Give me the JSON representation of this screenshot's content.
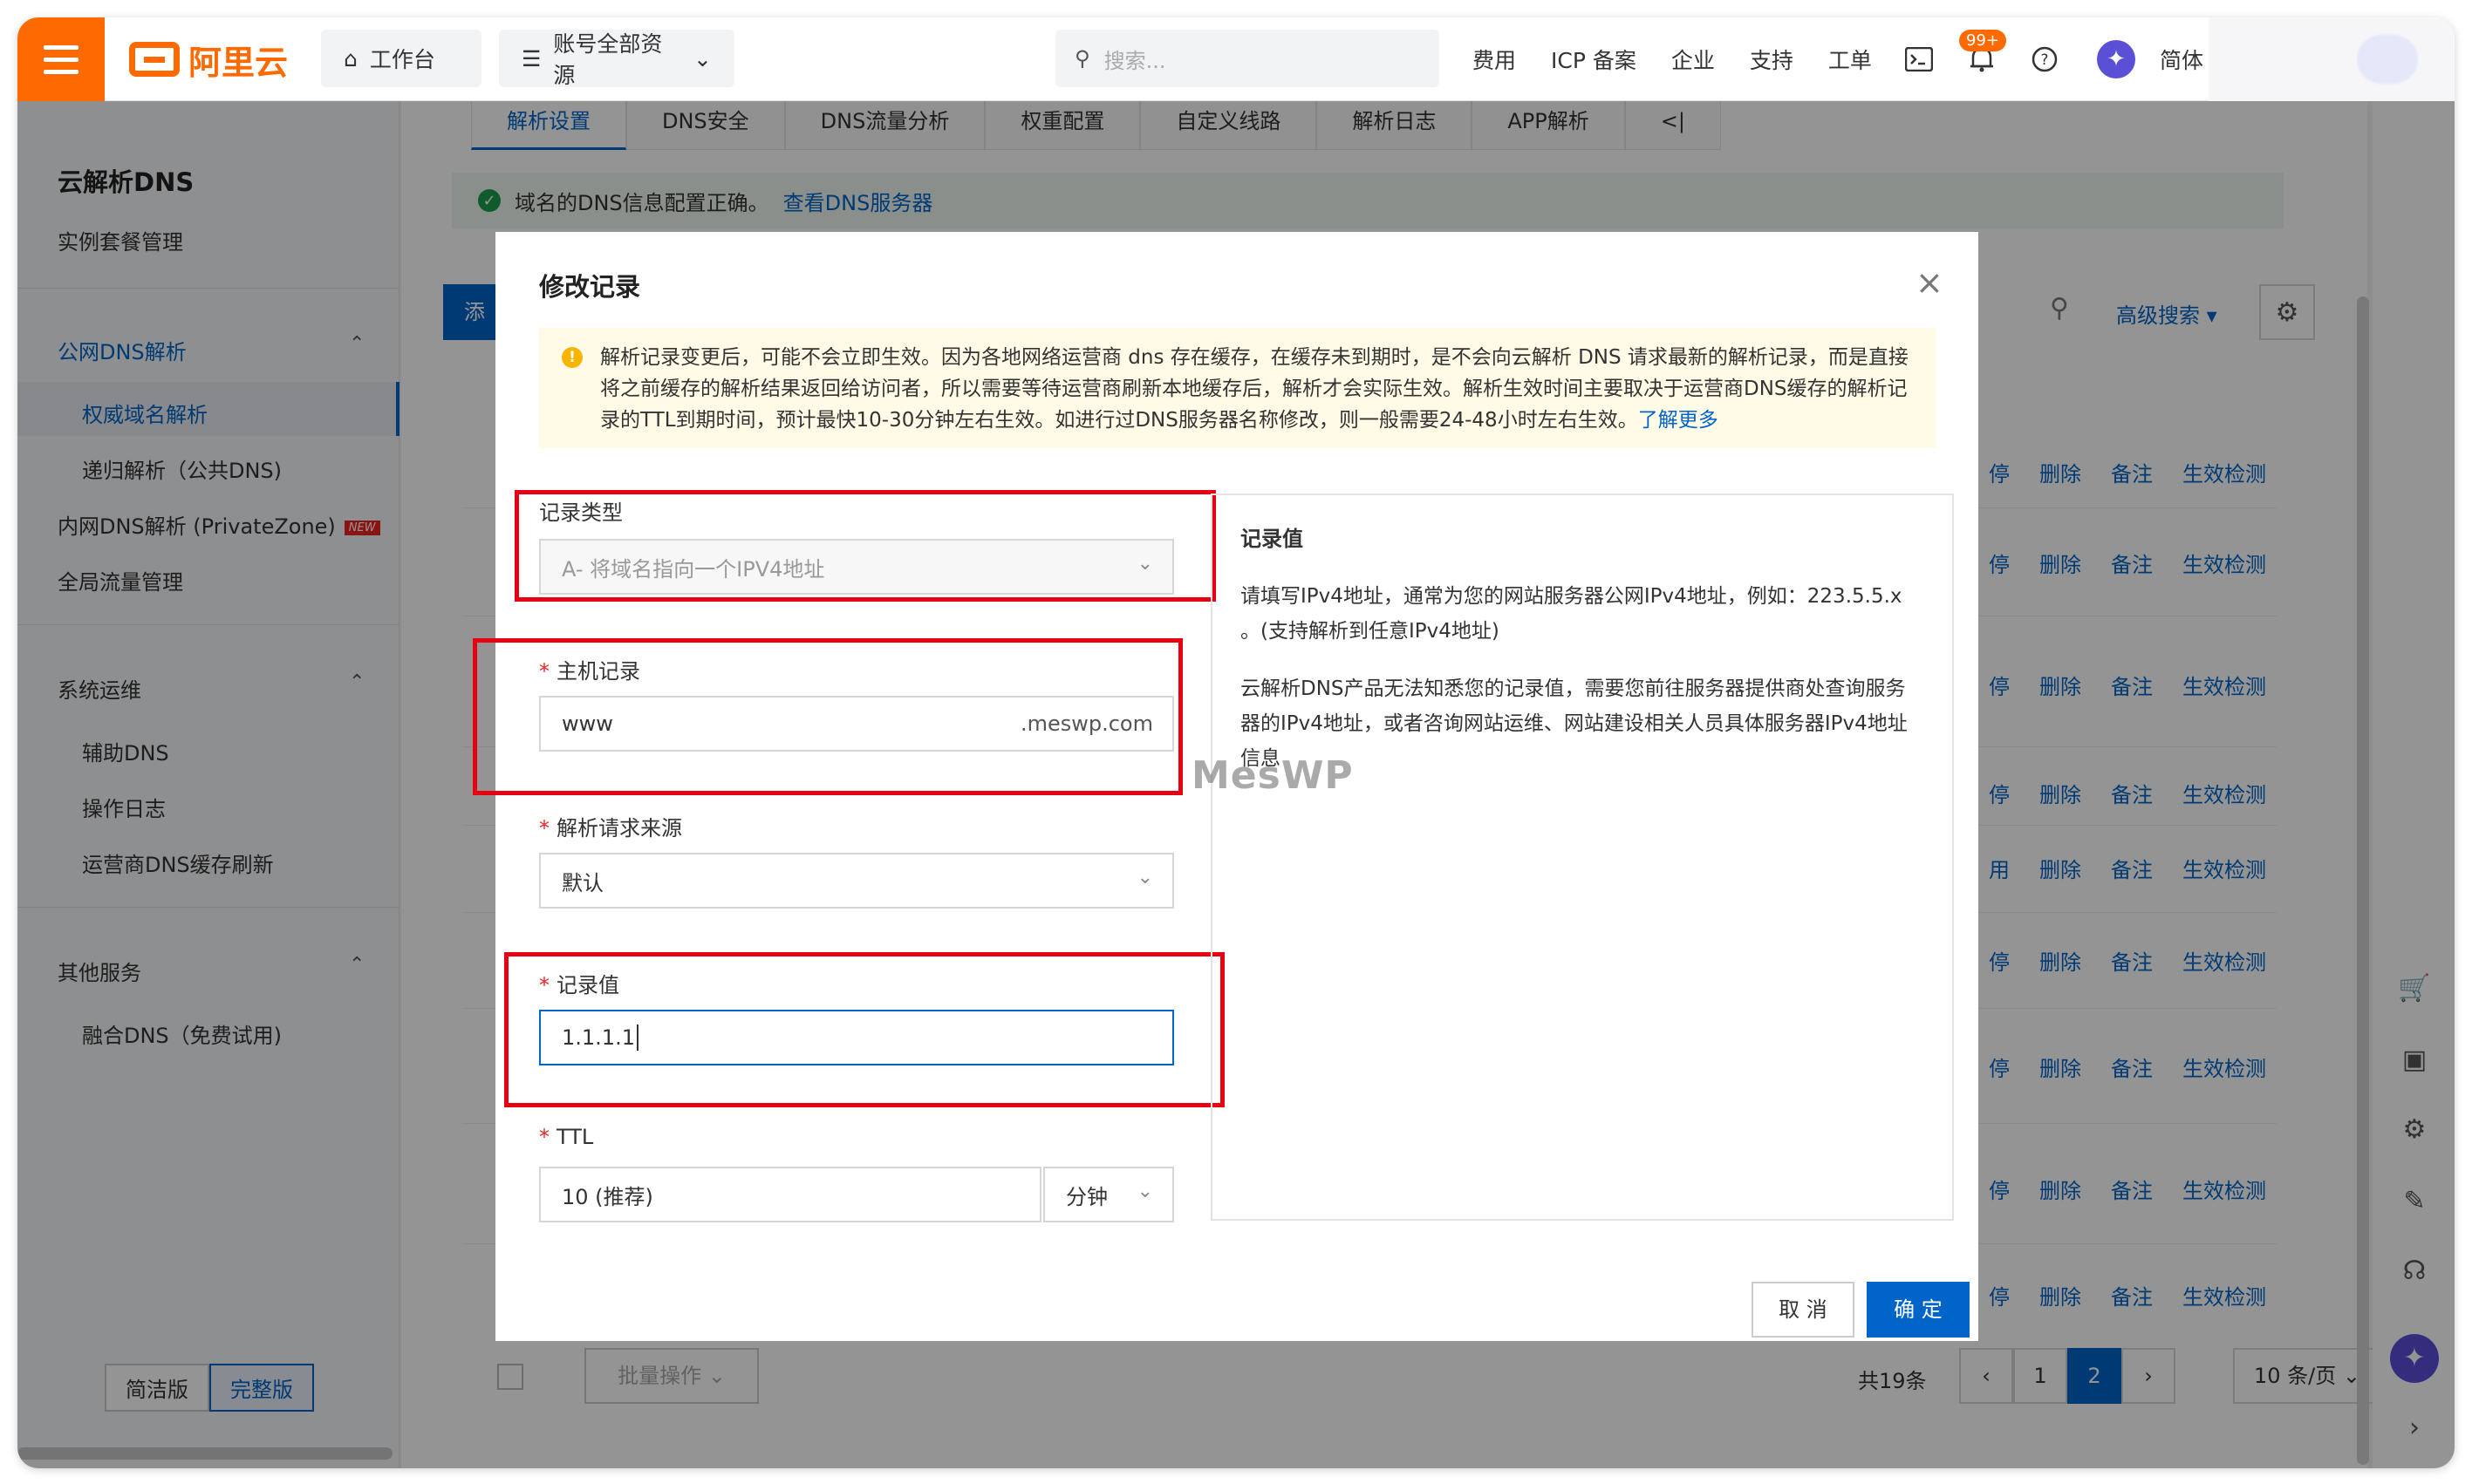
{
  "topbar": {
    "logo_text": "阿里云",
    "workbench": "工作台",
    "resources": "账号全部资源",
    "search_placeholder": "搜索...",
    "links": [
      "费用",
      "ICP 备案",
      "企业",
      "支持",
      "工单"
    ],
    "notification_badge": "99+",
    "language": "简体"
  },
  "sidebar": {
    "title": "云解析DNS",
    "instance_mgmt": "实例套餐管理",
    "public_group": "公网DNS解析",
    "authoritative": "权威域名解析",
    "recursive": "递归解析（公共DNS)",
    "private_zone": "内网DNS解析 (PrivateZone)",
    "new_badge": "NEW",
    "global_traffic": "全局流量管理",
    "ops_group": "系统运维",
    "aux_dns": "辅助DNS",
    "op_log": "操作日志",
    "isp_refresh": "运营商DNS缓存刷新",
    "other_group": "其他服务",
    "fusion_dns": "融合DNS（免费试用)",
    "simple_version": "简洁版",
    "full_version": "完整版"
  },
  "main": {
    "tabs": [
      "解析设置",
      "DNS安全",
      "DNS流量分析",
      "权重配置",
      "自定义线路",
      "解析日志",
      "APP解析",
      "<|"
    ],
    "notice_text": "域名的DNS信息配置正确。",
    "notice_link": "查看DNS服务器",
    "add_button": "添",
    "advanced_search": "高级搜索",
    "row_actions": [
      "删除",
      "备注",
      "生效检测"
    ],
    "row_prefix": [
      "停",
      "停",
      "停",
      "停",
      "用",
      "停",
      "停",
      "停",
      "停"
    ],
    "batch_button": "批量操作",
    "total": "共19条",
    "pages": [
      "1",
      "2"
    ],
    "current_page": "2",
    "page_size": "10 条/页"
  },
  "modal": {
    "title": "修改记录",
    "warning": "解析记录变更后，可能不会立即生效。因为各地网络运营商 dns 存在缓存，在缓存未到期时，是不会向云解析 DNS 请求最新的解析记录，而是直接将之前缓存的解析结果返回给访问者，所以需要等待运营商刷新本地缓存后，解析才会实际生效。解析生效时间主要取决于运营商DNS缓存的解析记录的TTL到期时间，预计最快10-30分钟左右生效。如进行过DNS服务器名称修改，则一般需要24-48小时左右生效。",
    "warning_link": "了解更多",
    "record_type_label": "记录类型",
    "record_type_value": "A- 将域名指向一个IPV4地址",
    "host_label": "主机记录",
    "host_value": "www",
    "host_suffix": ".meswp.com",
    "source_label": "解析请求来源",
    "source_value": "默认",
    "value_label": "记录值",
    "value_value": "1.1.1.1",
    "ttl_label": "TTL",
    "ttl_value": "10 (推荐)",
    "ttl_unit": "分钟",
    "help_title": "记录值",
    "help_p1": "请填写IPv4地址，通常为您的网站服务器公网IPv4地址，例如：223.5.5.x 。(支持解析到任意IPv4地址)",
    "help_p2": "云解析DNS产品无法知悉您的记录值，需要您前往服务器提供商处查询服务器的IPv4地址，或者咨询网站运维、网站建设相关人员具体服务器IPv4地址信息",
    "watermark": "MesWP",
    "cancel": "取 消",
    "confirm": "确 定"
  },
  "colors": {
    "brand": "#ff6a00",
    "primary": "#0064c8",
    "highlight": "#e60012"
  }
}
